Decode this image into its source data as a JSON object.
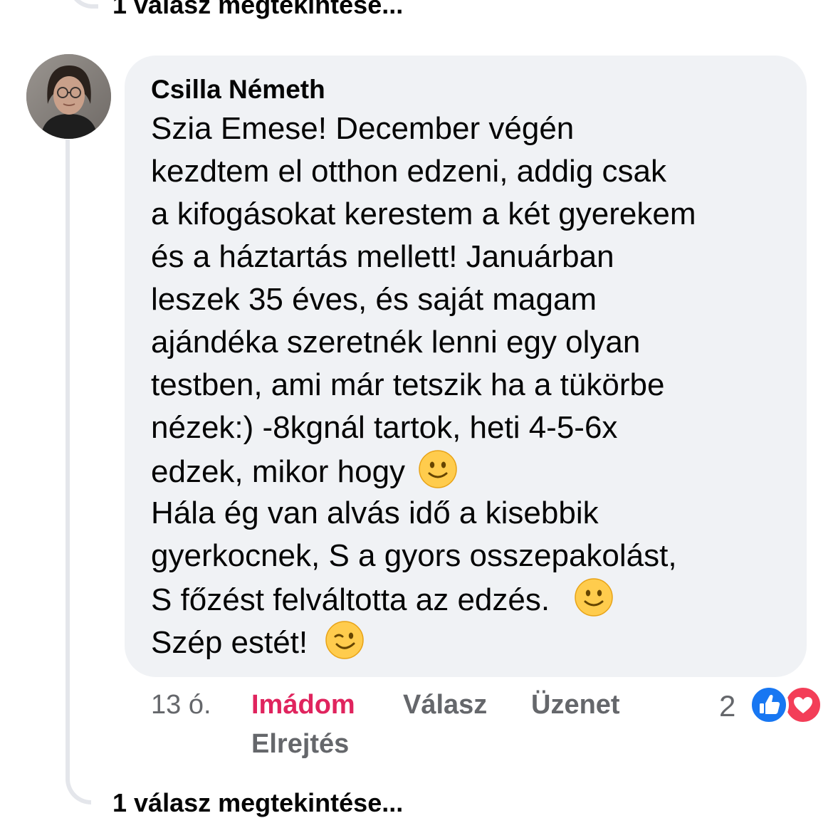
{
  "previous_thread": {
    "view_replies_label": "1 válasz megtekintése..."
  },
  "comment": {
    "author": "Csilla Németh",
    "lines": [
      "Szia Emese! December végén",
      "kezdtem el otthon edzeni, addig csak",
      "a kifogásokat kerestem a két gyerekem",
      "és a háztartás mellett! Januárban",
      "leszek 35 éves, és saját magam",
      "ajándéka szeretnék lenni egy olyan",
      "testben, ami már tetszik ha a tükörbe",
      "nézek:) -8kgnál tartok, heti 4-5-6x",
      "edzek, mikor hogy",
      "Hála ég van alvás idő a kisebbik",
      "gyerkocnek, S a gyors osszepakolást,",
      "S főzést felváltotta az edzés. ",
      "Szép estét!"
    ],
    "emojis": {
      "line_9": "slightly-smiling-face-icon",
      "line_12": "slightly-smiling-face-icon",
      "line_13": "winking-face-icon"
    }
  },
  "actions": {
    "time": "13 ó.",
    "love": "Imádom",
    "reply": "Válasz",
    "message": "Üzenet",
    "hide": "Elrejtés"
  },
  "reactions": {
    "count": "2",
    "icons": [
      "like-icon",
      "love-icon"
    ]
  },
  "thread": {
    "view_replies_label": "1 válasz megtekintése..."
  },
  "colors": {
    "bubble": "#f0f2f5",
    "secondary_text": "#65676b",
    "love_red": "#e0245e",
    "like_blue": "#1877f2",
    "thread_line": "#e4e6eb"
  }
}
